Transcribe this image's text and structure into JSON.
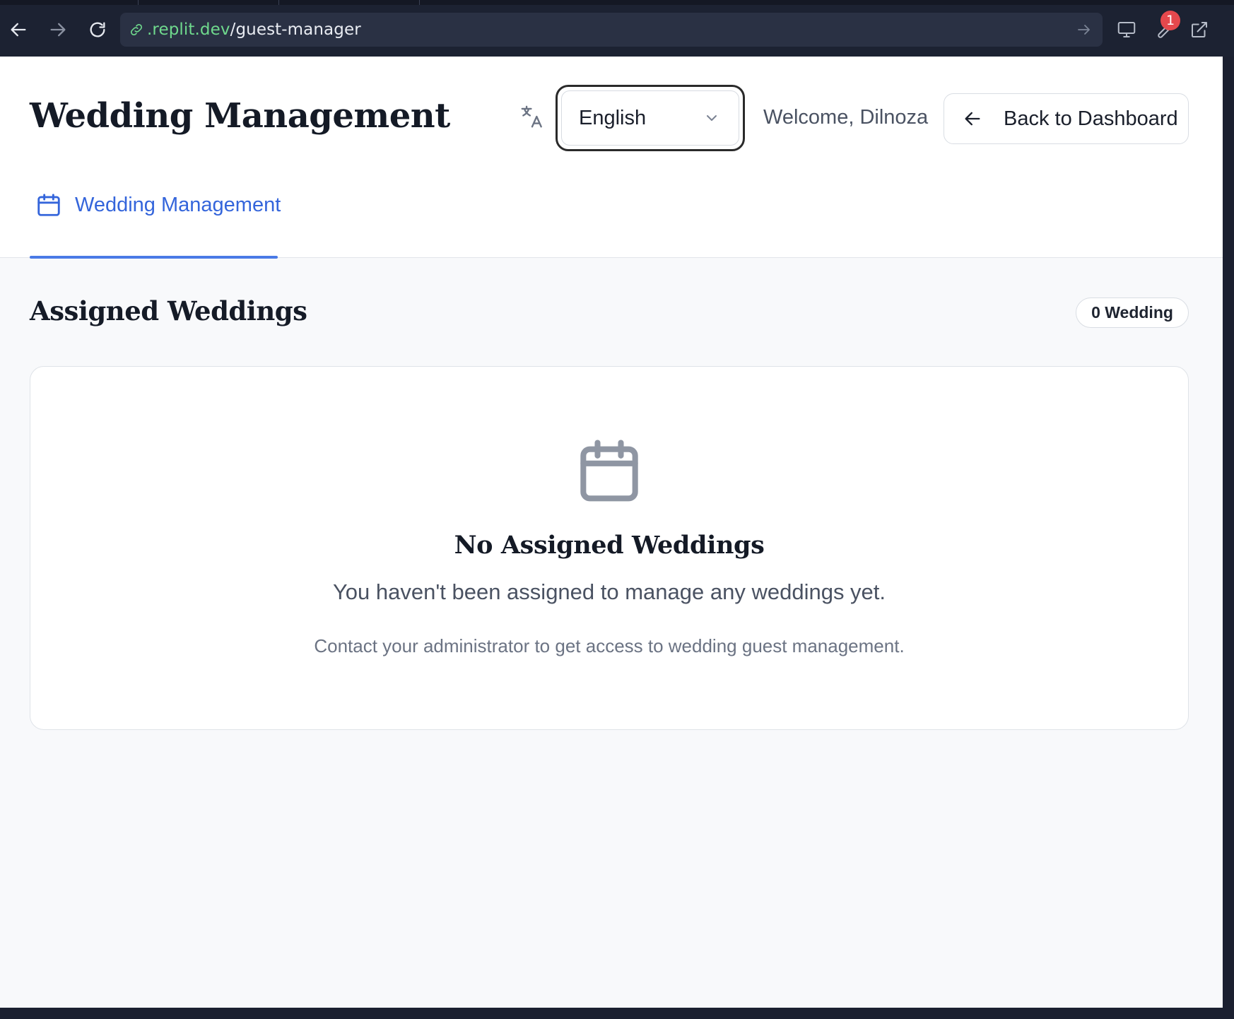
{
  "browser": {
    "url_domain": ".replit.dev",
    "url_path": "/guest-manager",
    "notification_count": "1",
    "icons": [
      "back-arrow-icon",
      "forward-arrow-icon",
      "reload-icon",
      "link-icon",
      "go-arrow-icon",
      "monitor-icon",
      "wrench-icon",
      "external-link-icon"
    ]
  },
  "header": {
    "title": "Wedding Management",
    "language": {
      "selected": "English",
      "icon": "translate-icon"
    },
    "welcome": "Welcome, Dilnoza",
    "back_button": "Back to Dashboard"
  },
  "tabs": [
    {
      "label": "Wedding Management",
      "icon": "calendar-icon",
      "active": true
    }
  ],
  "section": {
    "title": "Assigned Weddings",
    "count_badge": "0 Wedding"
  },
  "empty_state": {
    "icon": "calendar-icon",
    "title": "No Assigned Weddings",
    "subtitle": "You haven't been assigned to manage any weddings yet.",
    "hint": "Contact your administrator to get access to wedding guest management."
  },
  "colors": {
    "accent": "#3465db",
    "url_domain": "#6fd98d",
    "badge_red": "#e5484d"
  }
}
